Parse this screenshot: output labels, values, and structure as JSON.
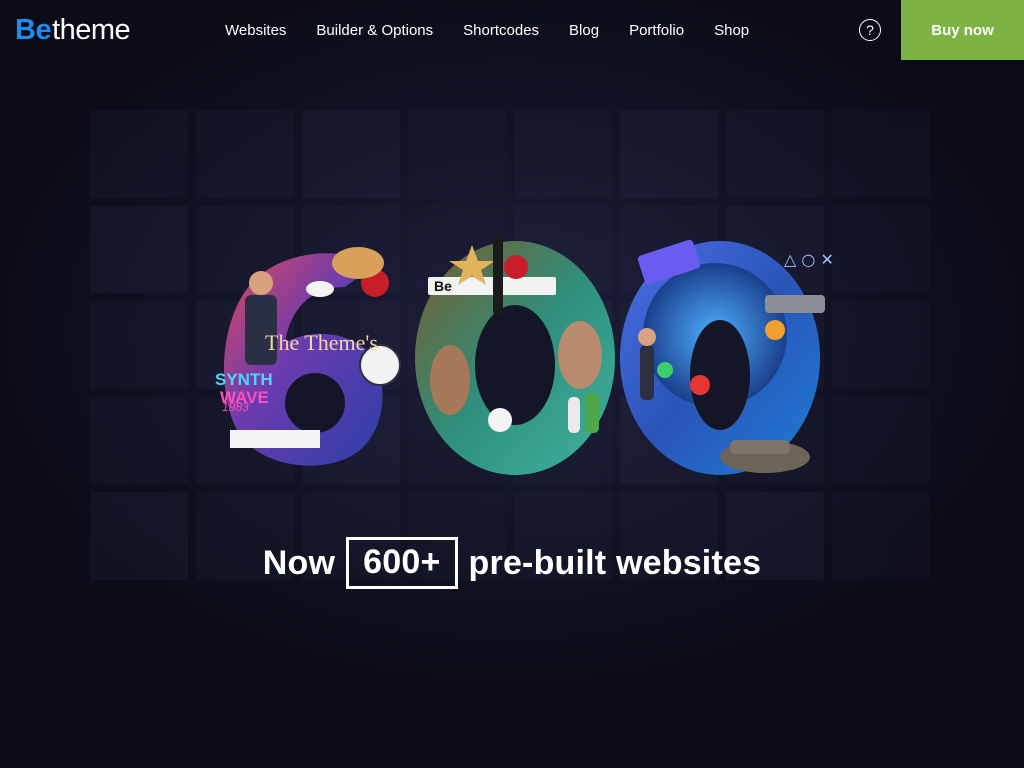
{
  "header": {
    "logo": {
      "be": "Be",
      "theme": "theme"
    },
    "nav": [
      "Websites",
      "Builder & Options",
      "Shortcodes",
      "Blog",
      "Portfolio",
      "Shop"
    ],
    "help_icon_label": "?",
    "buy_label": "Buy now"
  },
  "hero": {
    "headline_pre": "Now",
    "headline_highlight": "600+",
    "headline_post": "pre-built websites",
    "collage_texts": {
      "theme_title": "The Theme's",
      "synth": "SYNTH",
      "wave": "WAVE",
      "year": "1983",
      "be_badge": "Be"
    }
  },
  "colors": {
    "background": "#0b0c17",
    "brand_blue": "#1f8cf0",
    "buy_green": "#7cb342"
  }
}
